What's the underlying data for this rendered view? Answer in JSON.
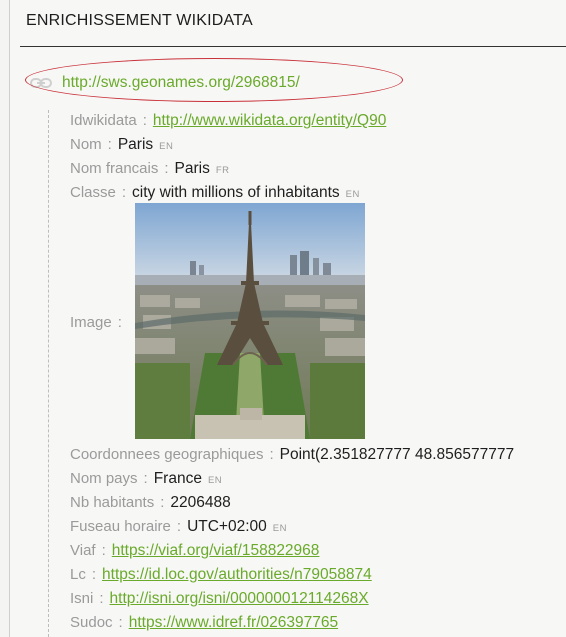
{
  "section": {
    "title": "ENRICHISSEMENT WIKIDATA"
  },
  "geo": {
    "icon": "link-icon",
    "url": "http://sws.geonames.org/2968815/"
  },
  "props": {
    "idwikidata": {
      "key": "Idwikidata",
      "sep": ":",
      "value": "http://www.wikidata.org/entity/Q90"
    },
    "nom": {
      "key": "Nom",
      "sep": ":",
      "value": "Paris",
      "lang": "EN"
    },
    "nom_francais": {
      "key": "Nom francais",
      "sep": ":",
      "value": "Paris",
      "lang": "FR"
    },
    "classe": {
      "key": "Classe",
      "sep": ":",
      "value": "city with millions of inhabitants",
      "lang": "EN"
    },
    "image": {
      "key": "Image",
      "sep": ":"
    },
    "coordonnees": {
      "key": "Coordonnees geographiques",
      "sep": ":",
      "value": "Point(2.351827777 48.856577777"
    },
    "nom_pays": {
      "key": "Nom pays",
      "sep": ":",
      "value": "France",
      "lang": "EN"
    },
    "nb_habitants": {
      "key": "Nb habitants",
      "sep": ":",
      "value": "2206488"
    },
    "fuseau": {
      "key": "Fuseau horaire",
      "sep": ":",
      "value": "UTC+02:00",
      "lang": "EN"
    },
    "viaf": {
      "key": "Viaf",
      "sep": ":",
      "value": "https://viaf.org/viaf/158822968"
    },
    "lc": {
      "key": "Lc",
      "sep": ":",
      "value": "https://id.loc.gov/authorities/n79058874"
    },
    "isni": {
      "key": "Isni",
      "sep": ":",
      "value": "http://isni.org/isni/000000012114268X"
    },
    "sudoc": {
      "key": "Sudoc",
      "sep": ":",
      "value": "https://www.idref.fr/026397765"
    }
  },
  "colors": {
    "link": "#6aaa2b",
    "highlight_ellipse": "#c9313a",
    "key": "#9a9a9a"
  }
}
